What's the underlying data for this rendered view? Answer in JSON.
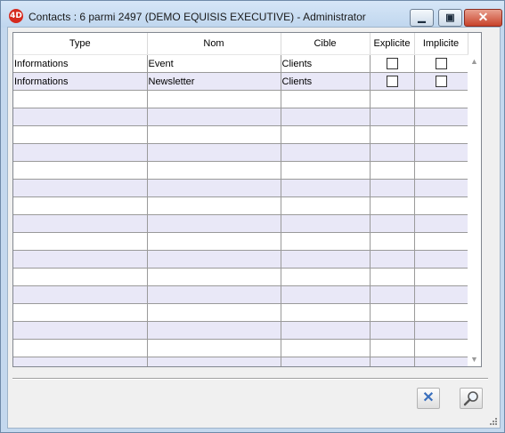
{
  "window": {
    "app_icon": "4D",
    "title": "Contacts : 6  parmi 2497 (DEMO EQUISIS EXECUTIVE) - Administrator",
    "minimize_label": "▁",
    "maximize_label": "▣",
    "close_label": "✕"
  },
  "table": {
    "columns": [
      "Type",
      "Nom",
      "Cible",
      "Explicite",
      "Implicite"
    ],
    "rows": [
      {
        "type": "Informations",
        "nom": "Event",
        "cible": "Clients",
        "explicite": false,
        "implicite": false
      },
      {
        "type": "Informations",
        "nom": "Newsletter",
        "cible": "Clients",
        "explicite": false,
        "implicite": false
      }
    ],
    "empty_rows": 16
  },
  "scrollbar": {
    "up_icon": "chevron-up-icon",
    "down_icon": "chevron-down-icon"
  },
  "toolbar": {
    "cancel_icon": "close-x-icon",
    "search_icon": "magnifier-icon"
  },
  "colors": {
    "alt_row": "#e9e8f7",
    "close_button": "#c8432b",
    "cancel_icon": "#3a6fbd"
  }
}
